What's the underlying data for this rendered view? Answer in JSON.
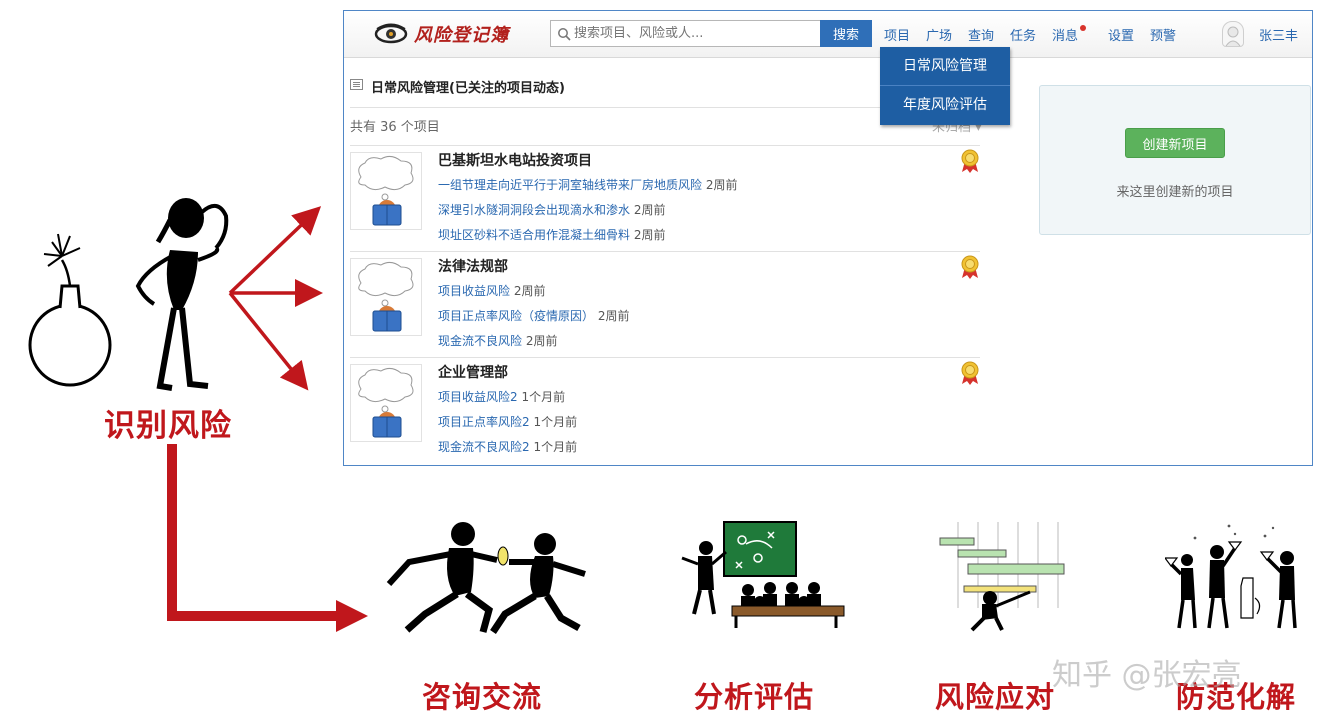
{
  "app": {
    "logo_text": "风险登记簿",
    "search": {
      "placeholder": "搜索项目、风险或人...",
      "button_label": "搜索"
    },
    "nav": {
      "projects": "项目",
      "plaza": "广场",
      "query": "查询",
      "tasks": "任务",
      "messages": "消息",
      "settings": "设置",
      "alerts": "预警"
    },
    "user_name": "张三丰",
    "dropdown": [
      "日常风险管理",
      "年度风险评估"
    ],
    "section_title": "日常风险管理(已关注的项目动态)",
    "project_count": "共有 36 个项目",
    "sort_label": "未归档 ▾",
    "projects": [
      {
        "name": "巴基斯坦水电站投资项目",
        "risks": [
          {
            "title": "一组节理走向近平行于洞室轴线带来厂房地质风险",
            "time": "2周前"
          },
          {
            "title": "深埋引水隧洞洞段会出现滴水和渗水",
            "time": "2周前"
          },
          {
            "title": "坝址区砂料不适合用作混凝土细骨料",
            "time": "2周前"
          }
        ]
      },
      {
        "name": "法律法规部",
        "risks": [
          {
            "title": "项目收益风险",
            "time": "2周前"
          },
          {
            "title": "项目正点率风险（疫情原因）",
            "time": "2周前"
          },
          {
            "title": "现金流不良风险",
            "time": "2周前"
          }
        ]
      },
      {
        "name": "企业管理部",
        "risks": [
          {
            "title": "项目收益风险2",
            "time": "1个月前"
          },
          {
            "title": "项目正点率风险2",
            "time": "1个月前"
          },
          {
            "title": "现金流不良风险2",
            "time": "1个月前"
          }
        ]
      }
    ],
    "new_project": {
      "button_label": "创建新项目",
      "hint": "来这里创建新的项目"
    }
  },
  "slide": {
    "identify_label": "识别风险",
    "stages": [
      "咨询交流",
      "分析评估",
      "风险应对",
      "防范化解"
    ],
    "watermark": "知乎 @张宏亮"
  },
  "colors": {
    "accent_red": "#c0171c",
    "link_blue": "#2a68b0",
    "nav_dropdown": "#1e5ea3",
    "create_green": "#5cb25c"
  }
}
